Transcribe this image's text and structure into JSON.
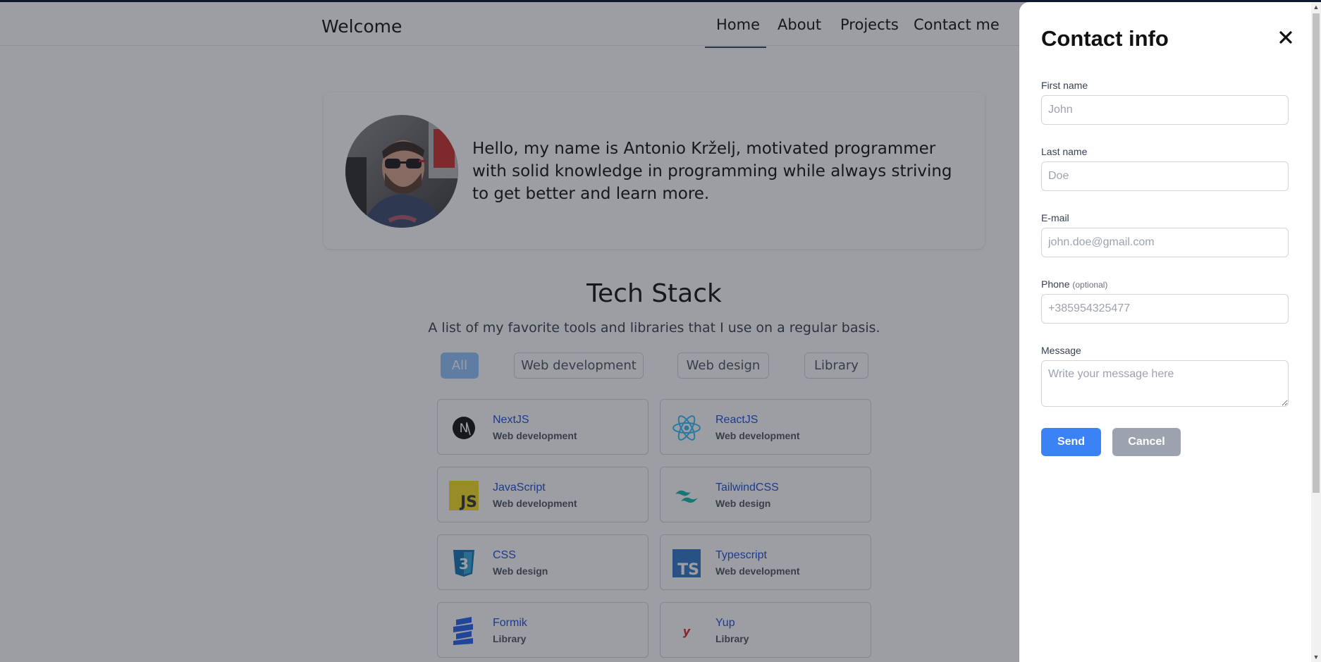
{
  "nav": {
    "brand": "Welcome",
    "links": [
      "Home",
      "About",
      "Projects",
      "Contact me"
    ],
    "active": "Home"
  },
  "hero": {
    "text": "Hello, my name is Antonio Krželj, motivated programmer with solid knowledge in programming while always striving to get better and learn more."
  },
  "tech_stack": {
    "title": "Tech Stack",
    "subtitle": "A list of my favorite tools and libraries that I use on a regular basis.",
    "filters": [
      "All",
      "Web development",
      "Web design",
      "Library"
    ],
    "active_filter": "All",
    "items": [
      {
        "name": "NextJS",
        "category": "Web development",
        "icon": "nextjs-icon"
      },
      {
        "name": "ReactJS",
        "category": "Web development",
        "icon": "react-icon"
      },
      {
        "name": "JavaScript",
        "category": "Web development",
        "icon": "javascript-icon"
      },
      {
        "name": "TailwindCSS",
        "category": "Web design",
        "icon": "tailwind-icon"
      },
      {
        "name": "CSS",
        "category": "Web design",
        "icon": "css3-icon"
      },
      {
        "name": "Typescript",
        "category": "Web development",
        "icon": "typescript-icon"
      },
      {
        "name": "Formik",
        "category": "Library",
        "icon": "formik-icon"
      },
      {
        "name": "Yup",
        "category": "Library",
        "icon": "yup-icon"
      }
    ]
  },
  "contact": {
    "title": "Contact info",
    "fields": {
      "first_name": {
        "label": "First name",
        "placeholder": "John",
        "value": ""
      },
      "last_name": {
        "label": "Last name",
        "placeholder": "Doe",
        "value": ""
      },
      "email": {
        "label": "E-mail",
        "placeholder": "john.doe@gmail.com",
        "value": ""
      },
      "phone": {
        "label": "Phone",
        "optional": "(optional)",
        "placeholder": "+385954325477",
        "value": ""
      },
      "message": {
        "label": "Message",
        "placeholder": "Write your message here",
        "value": ""
      }
    },
    "send_label": "Send",
    "cancel_label": "Cancel"
  },
  "colors": {
    "primary": "#3b82f6",
    "secondary": "#9ca3af",
    "link": "#1d4ed8",
    "overlay": "rgba(30,35,48,0.44)"
  }
}
